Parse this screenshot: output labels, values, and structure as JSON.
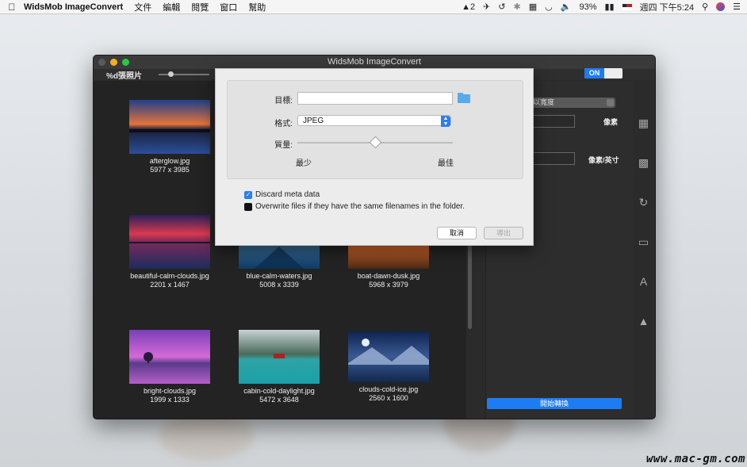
{
  "menubar": {
    "app_name": "WidsMob ImageConvert",
    "items": [
      "文件",
      "編輯",
      "閱覽",
      "窗口",
      "幫助"
    ],
    "status": {
      "monitor_text": "2",
      "battery_percent": "93%",
      "clock": "週四 下午5:24"
    }
  },
  "window": {
    "title": "WidsMob ImageConvert",
    "count_label": "%d張照片",
    "toggle_label": "ON"
  },
  "photos": [
    {
      "name": "afterglow.jpg",
      "dims": "5977 x 3985"
    },
    {
      "name": "beautiful-calm-clouds.jpg",
      "dims": "2201 x 1467"
    },
    {
      "name": "blue-calm-waters.jpg",
      "dims": "5008 x 3339"
    },
    {
      "name": "boat-dawn-dusk.jpg",
      "dims": "5968 x 3979"
    },
    {
      "name": "bright-clouds.jpg",
      "dims": "1999 x 1333"
    },
    {
      "name": "cabin-cold-daylight.jpg",
      "dims": "5472 x 3648"
    },
    {
      "name": "clouds-cold-ice.jpg",
      "dims": "2560 x 1600"
    }
  ],
  "panel": {
    "resize_select": "以寬度",
    "unit_pixels": "像素",
    "unit_ppi": "像素/英寸",
    "convert_button": "開始轉換"
  },
  "dialog": {
    "target_label": "目標:",
    "target_value": "",
    "format_label": "格式:",
    "format_value": "JPEG",
    "quality_label": "質量:",
    "quality_min": "最少",
    "quality_max": "最佳",
    "quality_level": 0.5,
    "discard_meta": {
      "label": "Discard meta data",
      "checked": true
    },
    "overwrite": {
      "label": "Overwrite files if they have the same filenames in the folder.",
      "checked": false
    },
    "cancel_label": "取消",
    "export_label": "導出"
  },
  "watermark": "www.mac-gm.com"
}
